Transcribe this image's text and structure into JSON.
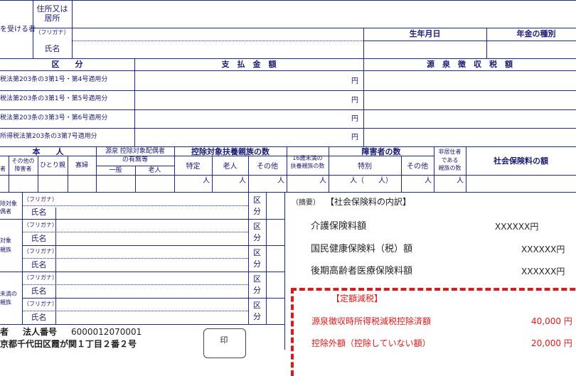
{
  "recipient": {
    "side_label": "を受ける者",
    "address_label_1": "住所又は",
    "address_label_2": "居所",
    "furigana_label": "（フリガナ）",
    "name_label": "氏名",
    "birthdate_label": "生年月日",
    "pension_type_label": "年金の種別"
  },
  "payments": {
    "category_header": "区　　分",
    "amount_header": "支　払　金　額",
    "tax_header": "源　泉　徴　収　税　額",
    "yen": "円",
    "rows": [
      "税法第203条の3第1号・第4号適用分",
      "税法第203条の3第1号・第5号適用分",
      "税法第203条の3第3号・第6号適用分",
      "所得税法第203条の3第7号適用分"
    ]
  },
  "deps": {
    "self_header": "本　　人",
    "self_col1": "者",
    "self_col2a": "その他の",
    "self_col2b": "障害者",
    "self_col3": "ひとり親",
    "self_col4": "寡婦",
    "spouse_header_1": "源泉 控除対象配偶者",
    "spouse_header_2": "の有無等",
    "spouse_general": "一般",
    "spouse_elderly": "老人",
    "dep_header": "控除対象扶養親族の数",
    "dep_specific": "特定",
    "dep_elderly": "老人",
    "dep_other": "その他",
    "under16_1": "16歳未満の",
    "under16_2": "扶養親族の数",
    "disabled_header": "障害者の数",
    "disabled_special": "特別",
    "disabled_other": "その他",
    "nonres_1": "非居住者",
    "nonres_2": "である",
    "nonres_3": "親族の数",
    "social_ins_header": "社会保険料の額",
    "unit_person": "人",
    "special_unit": "人（　　人）"
  },
  "family": {
    "side_1a": "除対象",
    "side_1b": "偶者",
    "side_2a": "対象",
    "side_2b": "親族",
    "side_3a": "未満の",
    "side_3b": "親族",
    "furigana": "（フリガナ）",
    "name": "氏名",
    "kubun_1": "区",
    "kubun_2": "分"
  },
  "summary": {
    "label": "（摘要）",
    "title": "【社会保険料の内訳】",
    "items": [
      {
        "name": "介護保険料額",
        "value": "XXXXXX円"
      },
      {
        "name": "国民健康保険料（税）額",
        "value": "XXXXXX円"
      },
      {
        "name": "後期高齢者医療保険料額",
        "value": "XXXXXX円"
      }
    ]
  },
  "reduction": {
    "title": "【定額減税】",
    "items": [
      {
        "name": "源泉徴収時所得税減税控除済額",
        "value": "40,000 円"
      },
      {
        "name": "控除外額（控除していない額）",
        "value": "20,000 円"
      }
    ],
    "color": "#e01818"
  },
  "payer": {
    "label": "者",
    "corp_label": "法人番号",
    "corp_number": "6000012070001",
    "address": "京都千代田区霞が関１丁目２番２号",
    "stamp": "印"
  }
}
